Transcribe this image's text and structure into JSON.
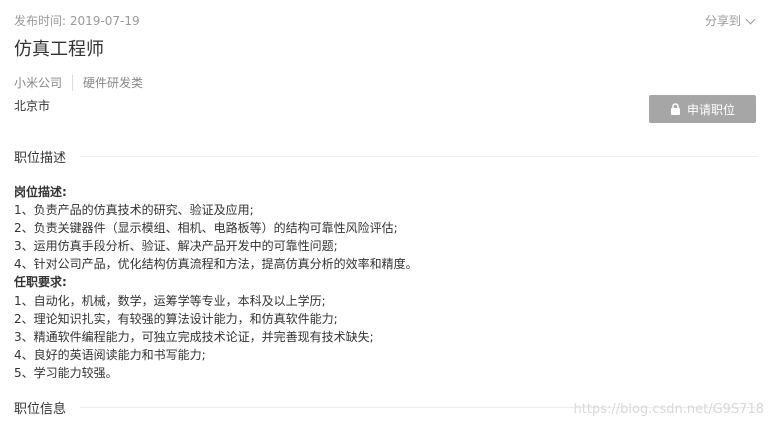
{
  "header": {
    "publish_label": "发布时间:",
    "publish_date": "2019-07-19",
    "share_label": "分享到",
    "job_title": "仿真工程师",
    "company": "小米公司",
    "category": "硬件研发类",
    "city": "北京市",
    "apply_label": "申请职位"
  },
  "sections": {
    "description_title": "职位描述",
    "info_title": "职位信息"
  },
  "description": {
    "duties_heading": "岗位描述:",
    "duties": [
      "1、负责产品的仿真技术的研究、验证及应用;",
      "2、负责关键器件（显示模组、相机、电路板等）的结构可靠性风险评估;",
      "3、运用仿真手段分析、验证、解决产品开发中的可靠性问题;",
      "4、针对公司产品，优化结构仿真流程和方法，提高仿真分析的效率和精度。"
    ],
    "requirements_heading": "任职要求:",
    "requirements": [
      "1、自动化，机械，数学，运筹学等专业，本科及以上学历;",
      "2、理论知识扎实，有较强的算法设计能力，和仿真软件能力;",
      "3、精通软件编程能力，可独立完成技术论证，并完善现有技术缺失;",
      "4、良好的英语阅读能力和书写能力;",
      "5、学习能力较强。"
    ]
  },
  "watermark": "https://blog.csdn.net/G9S718"
}
